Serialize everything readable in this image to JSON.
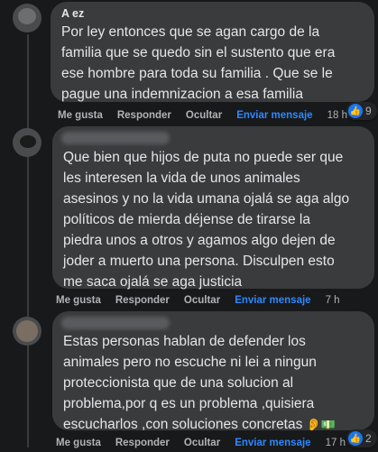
{
  "comments": [
    {
      "author": "A          ez",
      "text": "Por ley entonces que se agan cargo de la\nfamilia que se quedo sin el sustento que era\nese hombre para toda su familia . Que se le\npague una indemnizacion a esa familia",
      "actions": {
        "like": "Me gusta",
        "reply": "Responder",
        "hide": "Ocultar",
        "send": "Enviar mensaje",
        "time": "18 h"
      },
      "reaction_count": "9"
    },
    {
      "author": "",
      "text": "Que bien que hijos de puta no puede ser que\nles interesen la vida de unos animales\nasesinos y no la vida umana ojalá se aga algo\npolíticos de mierda déjense de tirarse la\npiedra unos a otros y agamos algo dejen de\njoder a muerto una persona. Disculpen esto\nme saca ojalá se aga justicia",
      "actions": {
        "like": "Me gusta",
        "reply": "Responder",
        "hide": "Ocultar",
        "send": "Enviar mensaje",
        "time": "7 h"
      }
    },
    {
      "author": "",
      "text": "Estas personas hablan de defender los\nanimales pero no escuche ni lei a ningun\nproteccionista que de una solucion al\nproblema,por q es un problema ,quisiera\nescucharlos ,con soluciones concretas",
      "emojis": "👂💵",
      "actions": {
        "like": "Me gusta",
        "reply": "Responder",
        "hide": "Ocultar",
        "send": "Enviar mensaje",
        "time": "17 h"
      },
      "reaction_count": "2"
    }
  ],
  "colors": {
    "background": "#18191a",
    "bubble": "#3a3b3c",
    "link": "#2d88ff",
    "like": "#1877f2"
  },
  "icons": {
    "like": "thumbs-up-icon"
  }
}
